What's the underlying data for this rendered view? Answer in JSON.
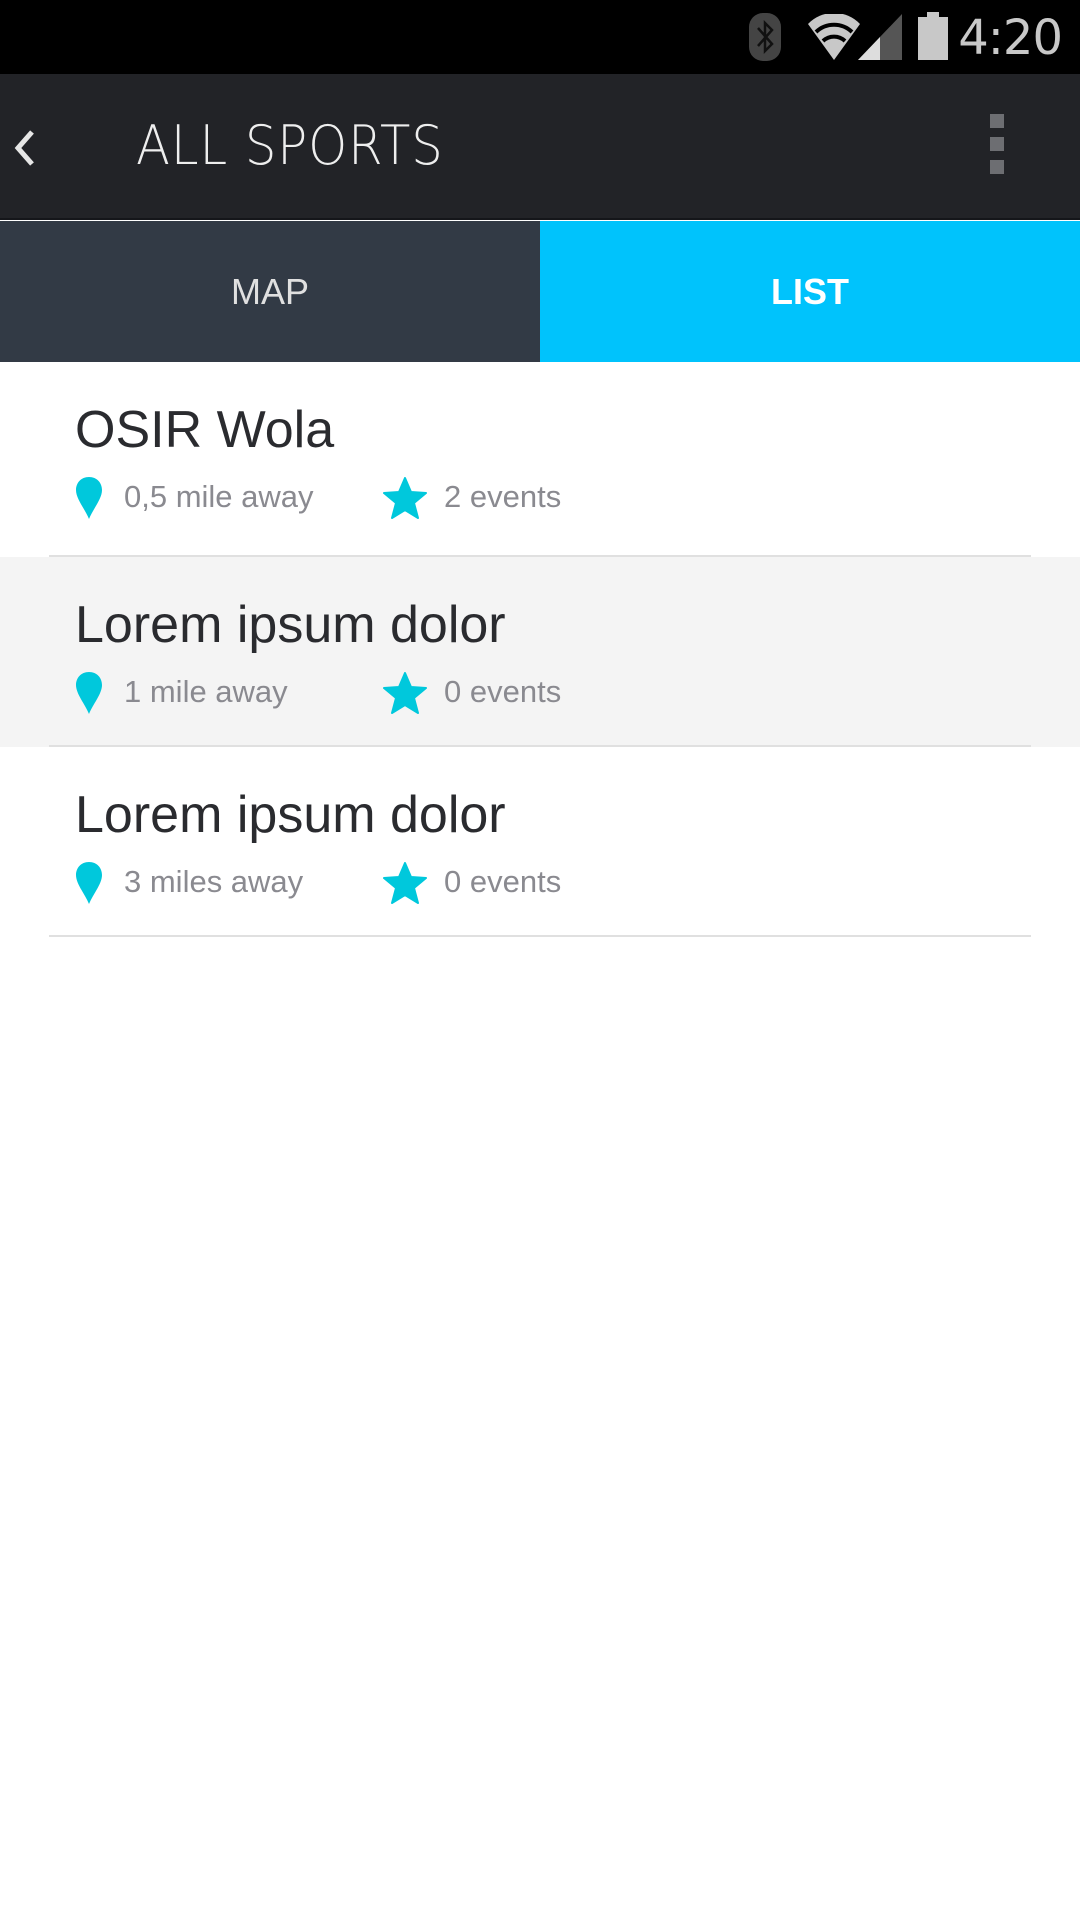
{
  "status_bar": {
    "time": "4:20",
    "icons": [
      "bluetooth-icon",
      "wifi-icon",
      "signal-icon",
      "battery-icon"
    ]
  },
  "app_bar": {
    "title": "ALL SPORTS",
    "back_icon": "chevron-left-icon",
    "menu_icon": "overflow-menu-icon"
  },
  "tabs": [
    {
      "label": "MAP",
      "active": false
    },
    {
      "label": "LIST",
      "active": true
    }
  ],
  "colors": {
    "accent": "#00c3fc",
    "icon": "#00c8dc",
    "appbar": "#222327",
    "tab_inactive": "#323a45"
  },
  "items": [
    {
      "name": "OSIR Wola",
      "distance": "0,5 mile away",
      "events": "2 events"
    },
    {
      "name": "Lorem ipsum dolor",
      "distance": "1 mile away",
      "events": "0 events"
    },
    {
      "name": "Lorem ipsum dolor",
      "distance": "3 miles away",
      "events": "0 events"
    }
  ]
}
